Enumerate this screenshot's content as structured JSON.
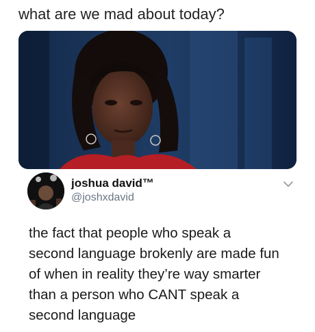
{
  "caption": "what are we mad about today?",
  "photo": {
    "background_color": "#1b3358",
    "accent_color": "#b51e24"
  },
  "tweet": {
    "display_name": "joshua david™",
    "handle": "@joshxdavid",
    "menu_icon": "chevron-down-icon",
    "text_lines": [
      "the fact that people who speak a",
      "second language brokenly are made fun",
      "of when in reality they’re way smarter",
      "than a person who CANT speak a",
      "second language"
    ]
  }
}
